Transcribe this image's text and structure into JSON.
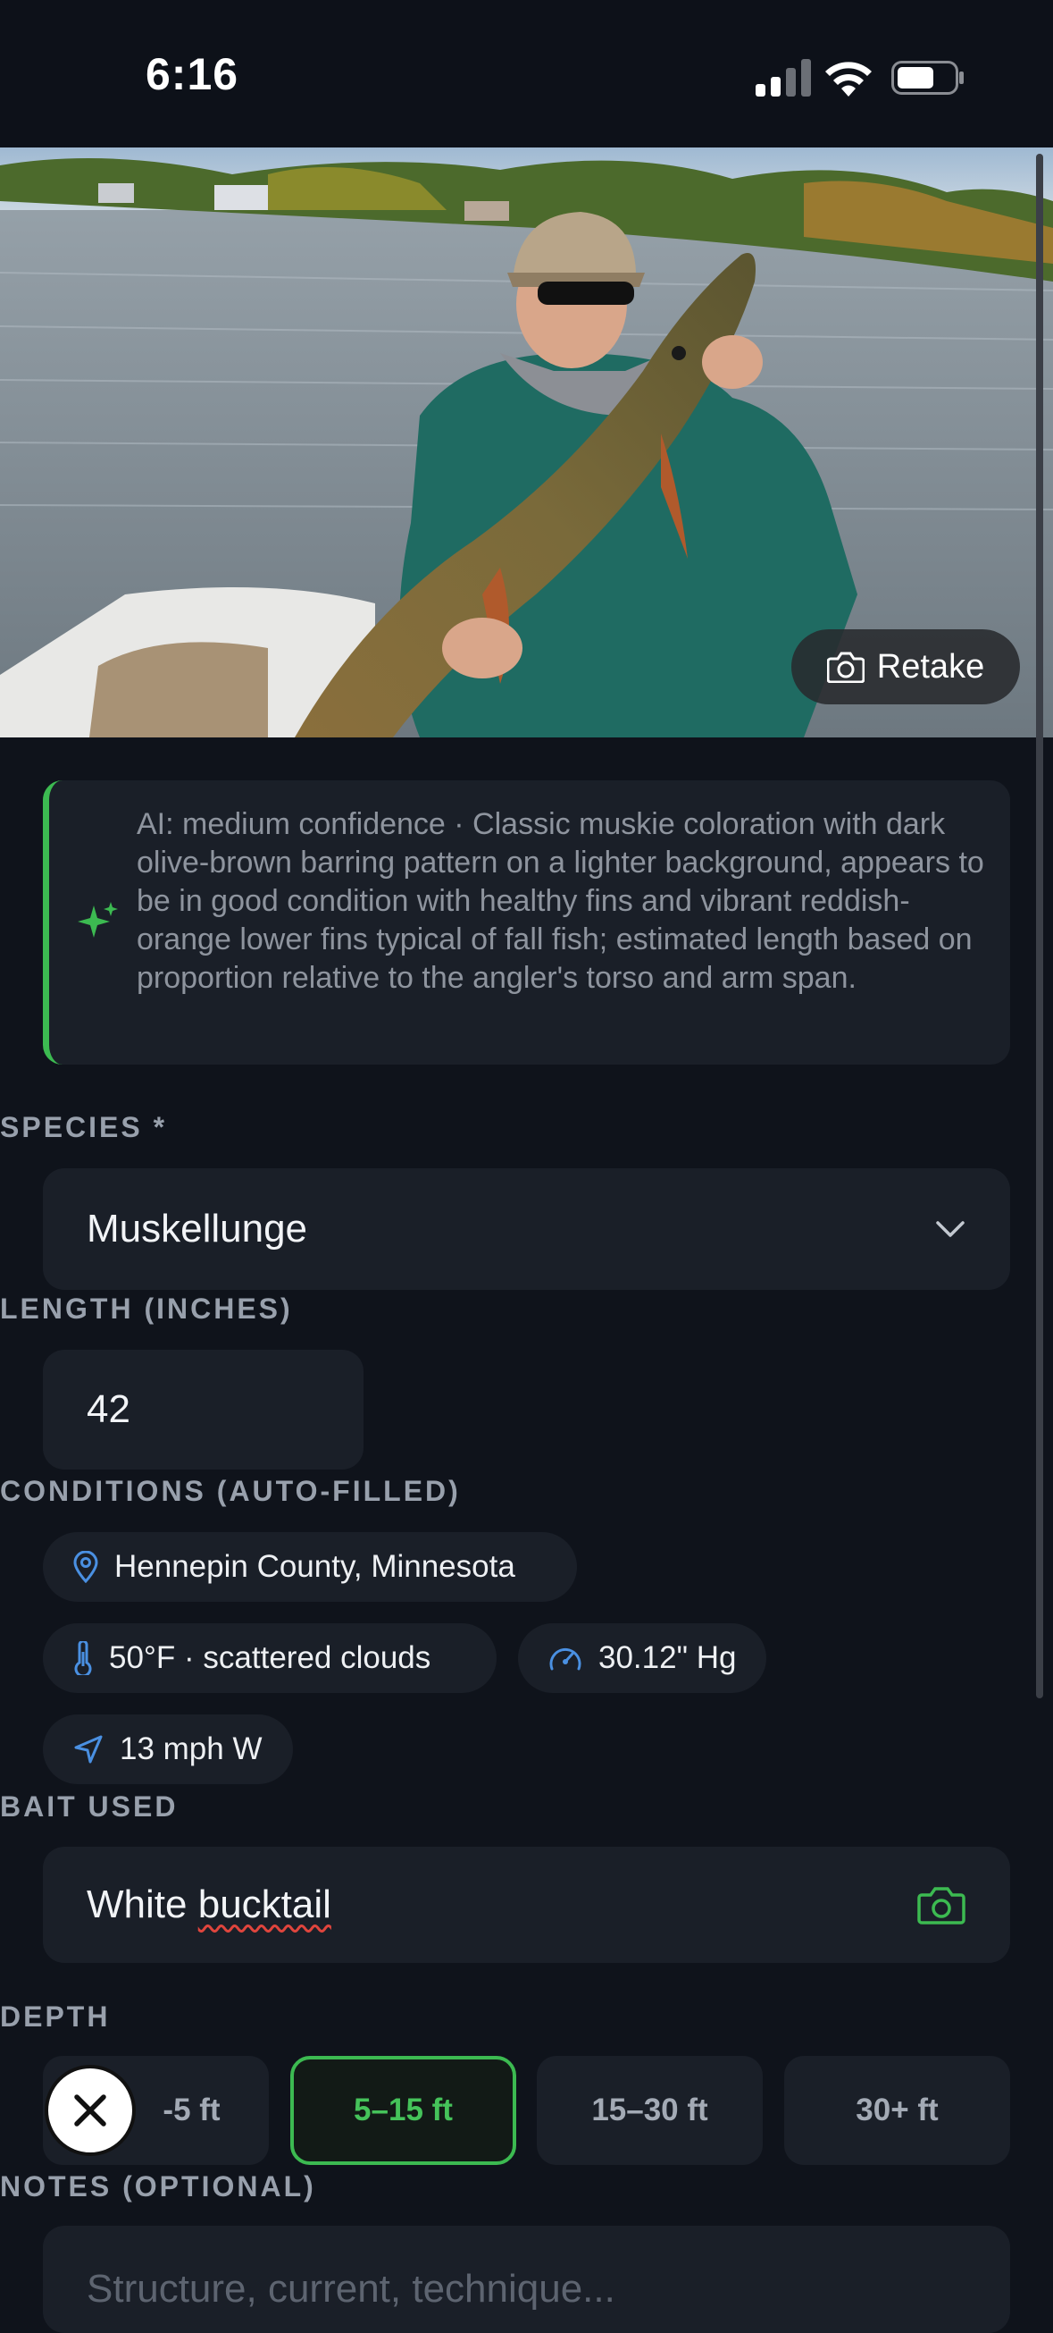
{
  "status_bar": {
    "time": "6:16"
  },
  "photo": {
    "retake_label": "Retake"
  },
  "ai_note": {
    "text": "AI: medium confidence · Classic muskie coloration with dark olive-brown barring pattern on a lighter background, appears to be in good condition with healthy fins and vibrant reddish-orange lower fins typical of fall fish; estimated length based on proportion relative to the angler's torso and arm span."
  },
  "species": {
    "label": "SPECIES *",
    "value": "Muskellunge"
  },
  "length": {
    "label": "LENGTH (INCHES)",
    "value": "42"
  },
  "conditions": {
    "label": "CONDITIONS (AUTO-FILLED)",
    "location": "Hennepin County, Minnesota",
    "weather": "50°F · scattered clouds",
    "pressure": "30.12\" Hg",
    "wind": "13 mph W"
  },
  "bait": {
    "label": "BAIT USED",
    "value_word1": "White",
    "value_word2": "bucktail"
  },
  "depth": {
    "label": "DEPTH",
    "options": [
      "0–5 ft",
      "5–15 ft",
      "15–30 ft",
      "30+ ft"
    ],
    "visible_first": "-5 ft",
    "selected": "5–15 ft"
  },
  "notes": {
    "label": "NOTES (OPTIONAL)",
    "placeholder": "Structure, current, technique..."
  },
  "colors": {
    "accent": "#3cba51",
    "background": "#0f131b",
    "card": "#1a1f28",
    "icon_blue": "#4a90e2"
  }
}
